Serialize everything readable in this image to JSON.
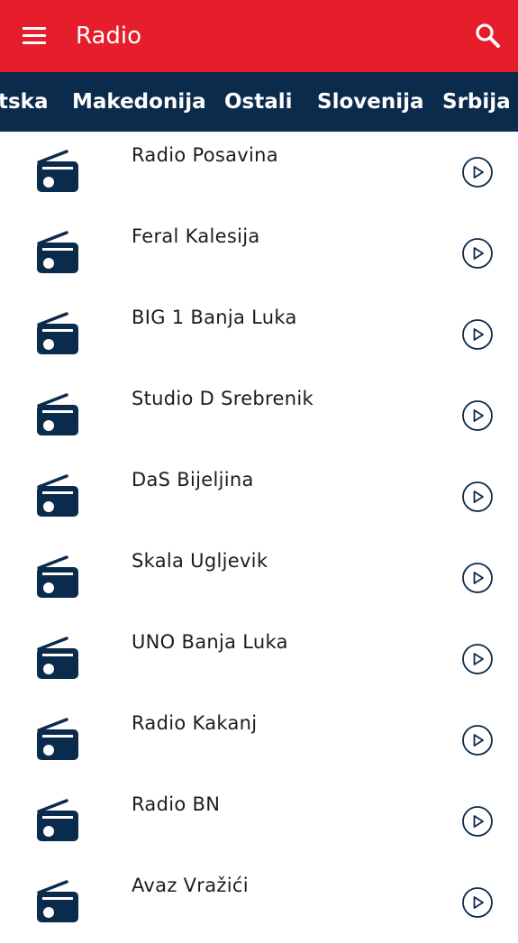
{
  "app_bar": {
    "title": "Radio",
    "background": "#e61e2b",
    "menu_icon": "hamburger-menu-icon",
    "search_icon": "search-icon"
  },
  "tabs": {
    "background": "#0b2b4c",
    "items": [
      {
        "label": "tska"
      },
      {
        "label": "Makedonija"
      },
      {
        "label": "Ostali"
      },
      {
        "label": "Slovenija"
      },
      {
        "label": "Srbija"
      }
    ]
  },
  "stations": [
    {
      "name": "Radio Posavina",
      "icon": "radio-icon",
      "action_icon": "play-circle-icon"
    },
    {
      "name": "Feral Kalesija",
      "icon": "radio-icon",
      "action_icon": "play-circle-icon"
    },
    {
      "name": "BIG 1 Banja Luka",
      "icon": "radio-icon",
      "action_icon": "play-circle-icon"
    },
    {
      "name": "Studio D Srebrenik",
      "icon": "radio-icon",
      "action_icon": "play-circle-icon"
    },
    {
      "name": "DaS Bijeljina",
      "icon": "radio-icon",
      "action_icon": "play-circle-icon"
    },
    {
      "name": "Skala Ugljevik",
      "icon": "radio-icon",
      "action_icon": "play-circle-icon"
    },
    {
      "name": "UNO Banja Luka",
      "icon": "radio-icon",
      "action_icon": "play-circle-icon"
    },
    {
      "name": "Radio Kakanj",
      "icon": "radio-icon",
      "action_icon": "play-circle-icon"
    },
    {
      "name": "Radio BN",
      "icon": "radio-icon",
      "action_icon": "play-circle-icon"
    },
    {
      "name": "Avaz Vražići",
      "icon": "radio-icon",
      "action_icon": "play-circle-icon"
    }
  ],
  "colors": {
    "icon_navy": "#0b2b4c",
    "divider": "#d6d6d6"
  }
}
